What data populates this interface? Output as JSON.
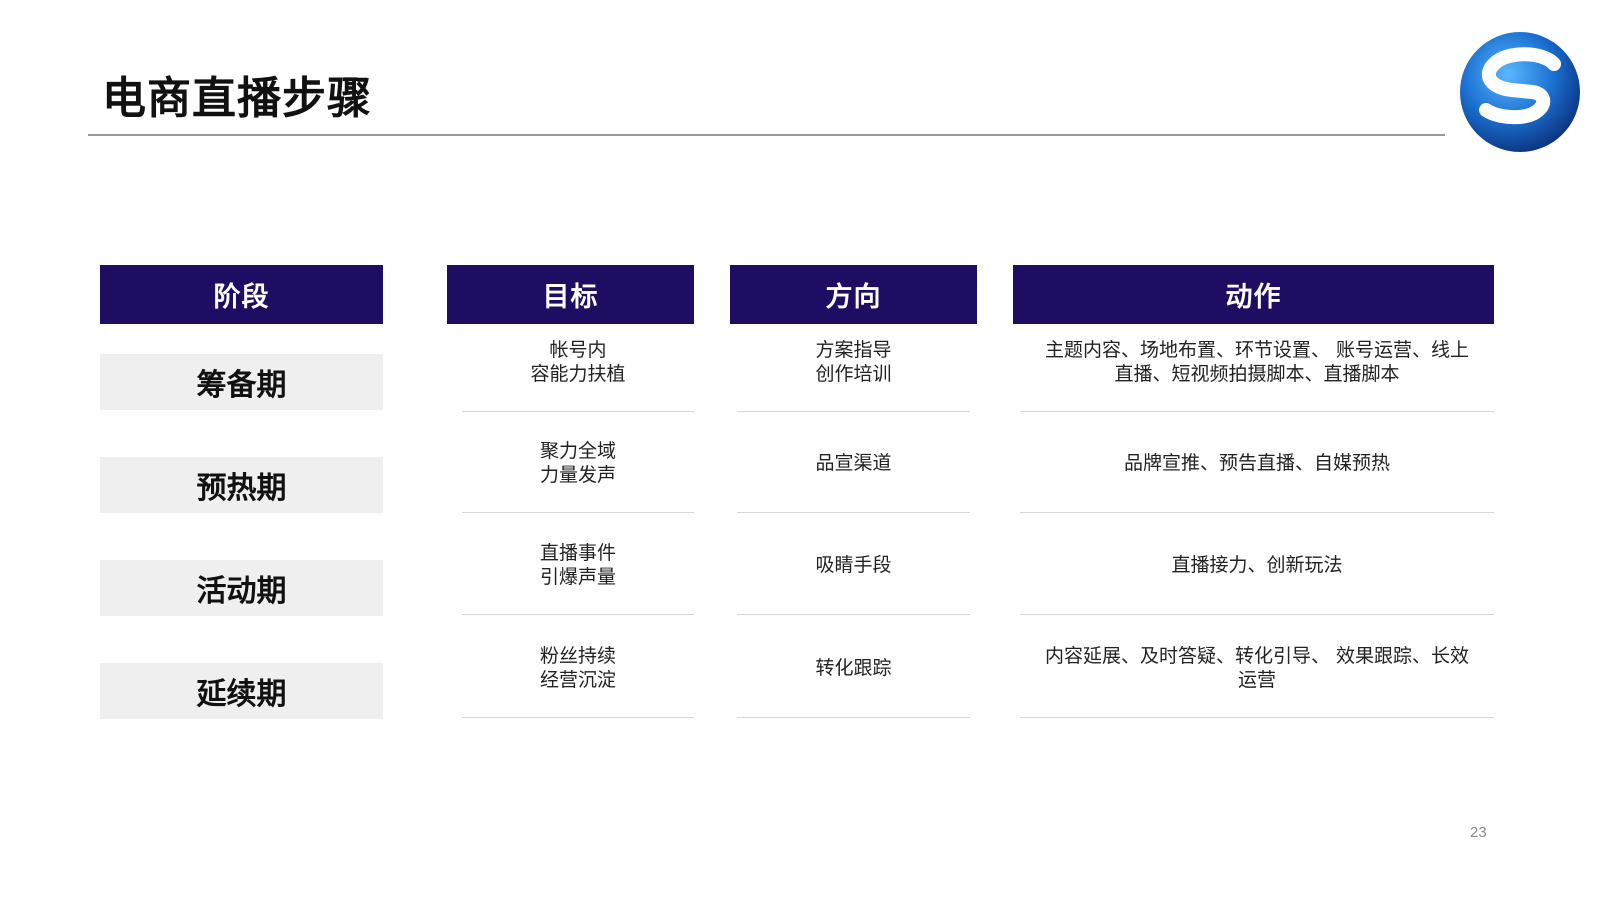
{
  "slide": {
    "title": "电商直播步骤",
    "page_number": "23"
  },
  "table": {
    "headers": {
      "stage": "阶段",
      "goal": "目标",
      "direction": "方向",
      "action": "动作"
    },
    "rows": [
      {
        "stage": "筹备期",
        "goal": "帐号内\n容能力扶植",
        "direction": "方案指导\n创作培训",
        "action": "主题内容、场地布置、环节设置、 账号运营、线上\n直播、短视频拍摄脚本、直播脚本"
      },
      {
        "stage": "预热期",
        "goal": "聚力全域\n力量发声",
        "direction": "品宣渠道",
        "action": "品牌宣推、预告直播、自媒预热"
      },
      {
        "stage": "活动期",
        "goal": "直播事件\n引爆声量",
        "direction": "吸睛手段",
        "action": "直播接力、创新玩法"
      },
      {
        "stage": "延续期",
        "goal": "粉丝持续\n经营沉淀",
        "direction": "转化跟踪",
        "action": "内容延展、及时答疑、转化引导、 效果跟踪、长效\n运营"
      }
    ]
  },
  "colors": {
    "header_bg": "#1f0d63",
    "stage_bg": "#efefef",
    "logo_blue": "#1a6fd0"
  },
  "logo": {
    "icon": "s-swirl-logo-icon"
  }
}
